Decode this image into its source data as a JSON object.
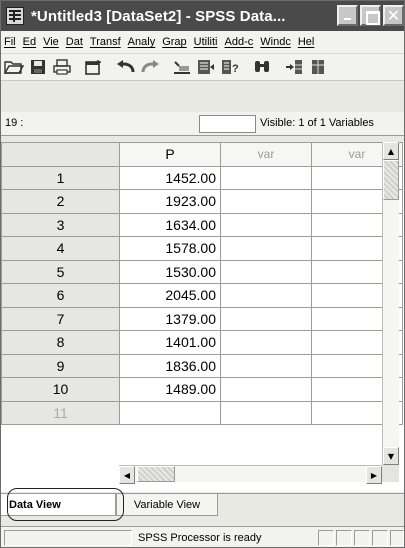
{
  "window": {
    "title": "*Untitled3 [DataSet2] - SPSS Data...",
    "controls": [
      "minimize",
      "maximize",
      "close"
    ]
  },
  "menubar": {
    "items": [
      "Fil",
      "Ed",
      "Vie",
      "Dat",
      "Transf",
      "Analy",
      "Grap",
      "Utiliti",
      "Add-c",
      "Windc",
      "Hel"
    ]
  },
  "toolbar": {
    "icons": [
      "open-icon",
      "save-icon",
      "print-icon",
      "dialog-recall-icon",
      "undo-icon",
      "redo-icon",
      "goto-case-icon",
      "variables-icon",
      "find-icon",
      "insert-cases-icon",
      "insert-variable-icon"
    ]
  },
  "cellbar": {
    "cell_ref": "19 :",
    "cell_value": "",
    "visible_label": "Visible: 1 of 1 Variables"
  },
  "grid": {
    "columns": [
      "P",
      "var",
      "var"
    ],
    "rows": [
      {
        "num": "1",
        "p": "1452.00"
      },
      {
        "num": "2",
        "p": "1923.00"
      },
      {
        "num": "3",
        "p": "1634.00"
      },
      {
        "num": "4",
        "p": "1578.00"
      },
      {
        "num": "5",
        "p": "1530.00"
      },
      {
        "num": "6",
        "p": "2045.00"
      },
      {
        "num": "7",
        "p": "1379.00"
      },
      {
        "num": "8",
        "p": "1401.00"
      },
      {
        "num": "9",
        "p": "1836.00"
      },
      {
        "num": "10",
        "p": "1489.00"
      },
      {
        "num": "11",
        "p": ""
      }
    ]
  },
  "tabs": {
    "data_view": "Data View",
    "variable_view": "Variable View"
  },
  "status": {
    "text": "SPSS  Processor is ready"
  }
}
